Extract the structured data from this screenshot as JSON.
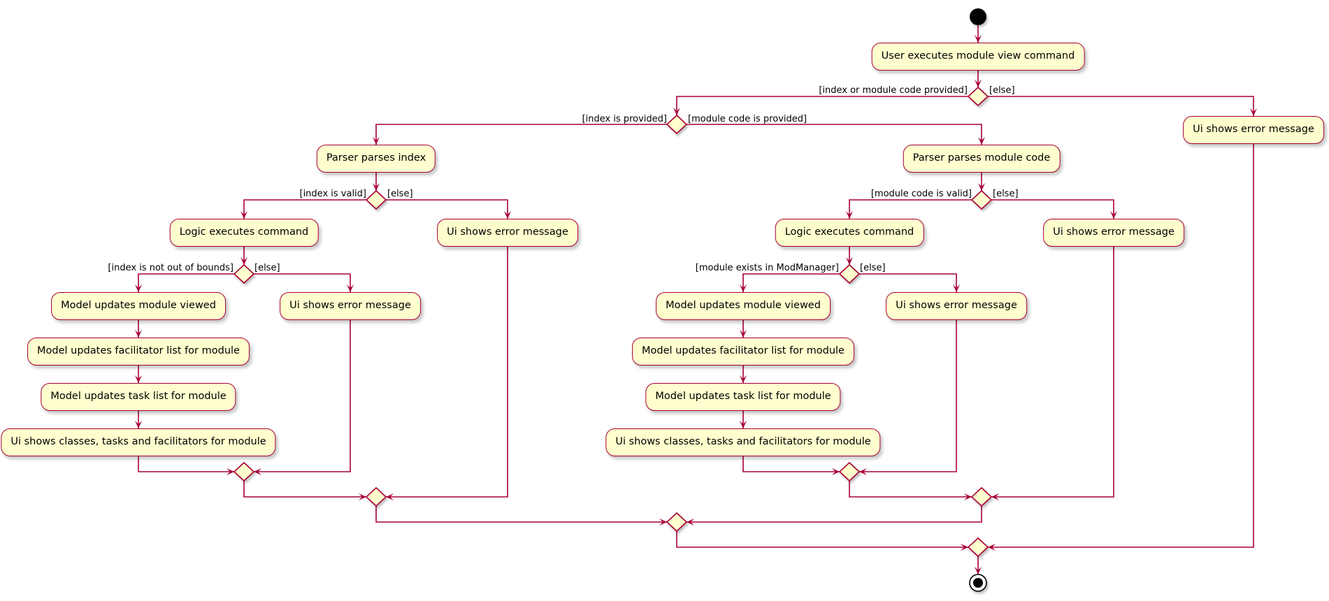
{
  "diagram": {
    "type": "activity",
    "colors": {
      "line": "#A80036",
      "fill": "#FEFECE",
      "start": "#000000"
    },
    "start": {
      "name": "start-node"
    },
    "end": {
      "name": "end-node"
    },
    "activities": {
      "user_executes": "User executes module view command",
      "ui_error_top": "Ui shows error message",
      "parser_index": "Parser parses index",
      "parser_module": "Parser parses module code",
      "logic_left": "Logic executes command",
      "ui_error_index_invalid": "Ui shows error message",
      "logic_right": "Logic executes command",
      "ui_error_module_invalid": "Ui shows error message",
      "model_viewed_left": "Model updates module viewed",
      "ui_error_bounds": "Ui shows error message",
      "model_facilitator_left": "Model updates facilitator list for module",
      "model_task_left": "Model updates task list for module",
      "ui_shows_left": "Ui shows classes, tasks and facilitators for module",
      "model_viewed_right": "Model updates module viewed",
      "ui_error_not_exists": "Ui shows error message",
      "model_facilitator_right": "Model updates facilitator list for module",
      "model_task_right": "Model updates task list for module",
      "ui_shows_right": "Ui shows classes, tasks and facilitators for module"
    },
    "guards": {
      "provided": "[index or module code provided]",
      "provided_else": "[else]",
      "index_provided": "[index is provided]",
      "module_provided": "[module code is provided]",
      "index_valid": "[index is valid]",
      "index_valid_else": "[else]",
      "module_valid": "[module code is valid]",
      "module_valid_else": "[else]",
      "in_bounds": "[index is not out of bounds]",
      "in_bounds_else": "[else]",
      "module_exists": "[module exists in ModManager]",
      "module_exists_else": "[else]"
    }
  }
}
